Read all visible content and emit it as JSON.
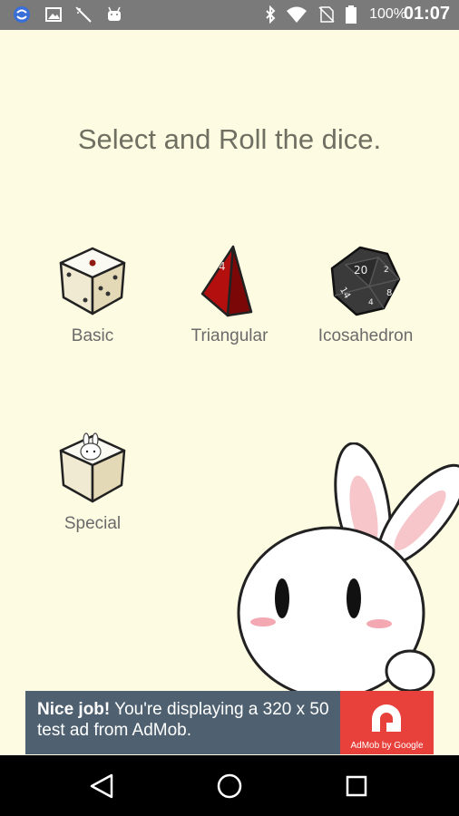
{
  "status_bar": {
    "icons": [
      "sync-icon",
      "image-icon",
      "magic-wand-icon",
      "android-icon",
      "bluetooth-icon",
      "wifi-icon",
      "no-sim-icon",
      "battery-icon"
    ],
    "battery": "100%",
    "time": "01:07"
  },
  "main": {
    "heading": "Select and Roll the dice.",
    "dice": [
      {
        "label": "Basic",
        "icon": "basic-die-icon"
      },
      {
        "label": "Triangular",
        "icon": "triangular-die-icon",
        "face_number": "4"
      },
      {
        "label": "Icosahedron",
        "icon": "icosahedron-die-icon",
        "face_numbers": [
          "20",
          "14",
          "8",
          "2",
          "4"
        ]
      },
      {
        "label": "Special",
        "icon": "special-die-icon"
      }
    ]
  },
  "ad": {
    "bold": "Nice job!",
    "text": " You're displaying a 320 x 50 test ad from AdMob.",
    "logo_caption": "AdMob by Google"
  },
  "nav_bar": {
    "buttons": [
      "back-button",
      "home-button",
      "recents-button"
    ]
  },
  "colors": {
    "background": "#fdfbe2",
    "status_bar": "#7a7a7a",
    "ad_background": "#4f6170",
    "admob_red": "#e8403b",
    "nav_bar": "#000000"
  }
}
